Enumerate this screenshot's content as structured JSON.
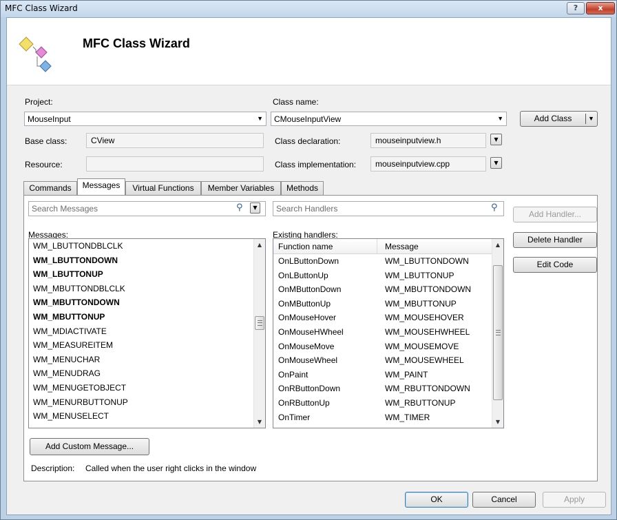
{
  "window": {
    "title": "MFC Class Wizard",
    "header_title": "MFC Class Wizard"
  },
  "project": {
    "label": "Project:",
    "value": "MouseInput"
  },
  "class_name": {
    "label": "Class name:",
    "value": "CMouseInputView"
  },
  "add_class_label": "Add Class",
  "base_class": {
    "label": "Base class:",
    "value": "CView"
  },
  "resource": {
    "label": "Resource:",
    "value": ""
  },
  "class_declaration": {
    "label": "Class declaration:",
    "value": "mouseinputview.h"
  },
  "class_implementation": {
    "label": "Class implementation:",
    "value": "mouseinputview.cpp"
  },
  "tabs": [
    "Commands",
    "Messages",
    "Virtual Functions",
    "Member Variables",
    "Methods"
  ],
  "active_tab": "Messages",
  "search_messages_placeholder": "Search Messages",
  "search_handlers_placeholder": "Search Handlers",
  "messages_label": "Messages:",
  "messages": [
    {
      "name": "WM_LBUTTONDBLCLK",
      "bold": false
    },
    {
      "name": "WM_LBUTTONDOWN",
      "bold": true
    },
    {
      "name": "WM_LBUTTONUP",
      "bold": true
    },
    {
      "name": "WM_MBUTTONDBLCLK",
      "bold": false
    },
    {
      "name": "WM_MBUTTONDOWN",
      "bold": true
    },
    {
      "name": "WM_MBUTTONUP",
      "bold": true
    },
    {
      "name": "WM_MDIACTIVATE",
      "bold": false
    },
    {
      "name": "WM_MEASUREITEM",
      "bold": false
    },
    {
      "name": "WM_MENUCHAR",
      "bold": false
    },
    {
      "name": "WM_MENUDRAG",
      "bold": false
    },
    {
      "name": "WM_MENUGETOBJECT",
      "bold": false
    },
    {
      "name": "WM_MENURBUTTONUP",
      "bold": false
    },
    {
      "name": "WM_MENUSELECT",
      "bold": false
    }
  ],
  "existing_handlers_label": "Existing handlers:",
  "handlers_columns": [
    "Function name",
    "Message"
  ],
  "handlers": [
    [
      "OnLButtonDown",
      "WM_LBUTTONDOWN"
    ],
    [
      "OnLButtonUp",
      "WM_LBUTTONUP"
    ],
    [
      "OnMButtonDown",
      "WM_MBUTTONDOWN"
    ],
    [
      "OnMButtonUp",
      "WM_MBUTTONUP"
    ],
    [
      "OnMouseHover",
      "WM_MOUSEHOVER"
    ],
    [
      "OnMouseHWheel",
      "WM_MOUSEHWHEEL"
    ],
    [
      "OnMouseMove",
      "WM_MOUSEMOVE"
    ],
    [
      "OnMouseWheel",
      "WM_MOUSEWHEEL"
    ],
    [
      "OnPaint",
      "WM_PAINT"
    ],
    [
      "OnRButtonDown",
      "WM_RBUTTONDOWN"
    ],
    [
      "OnRButtonUp",
      "WM_RBUTTONUP"
    ],
    [
      "OnTimer",
      "WM_TIMER"
    ]
  ],
  "add_handler_label": "Add Handler...",
  "delete_handler_label": "Delete Handler",
  "edit_code_label": "Edit Code",
  "add_custom_message_label": "Add Custom Message...",
  "description": {
    "label": "Description:",
    "text": "Called when the user right clicks in the window"
  },
  "ok_label": "OK",
  "cancel_label": "Cancel",
  "apply_label": "Apply",
  "help_button_label": "?",
  "close_button_label": "x"
}
